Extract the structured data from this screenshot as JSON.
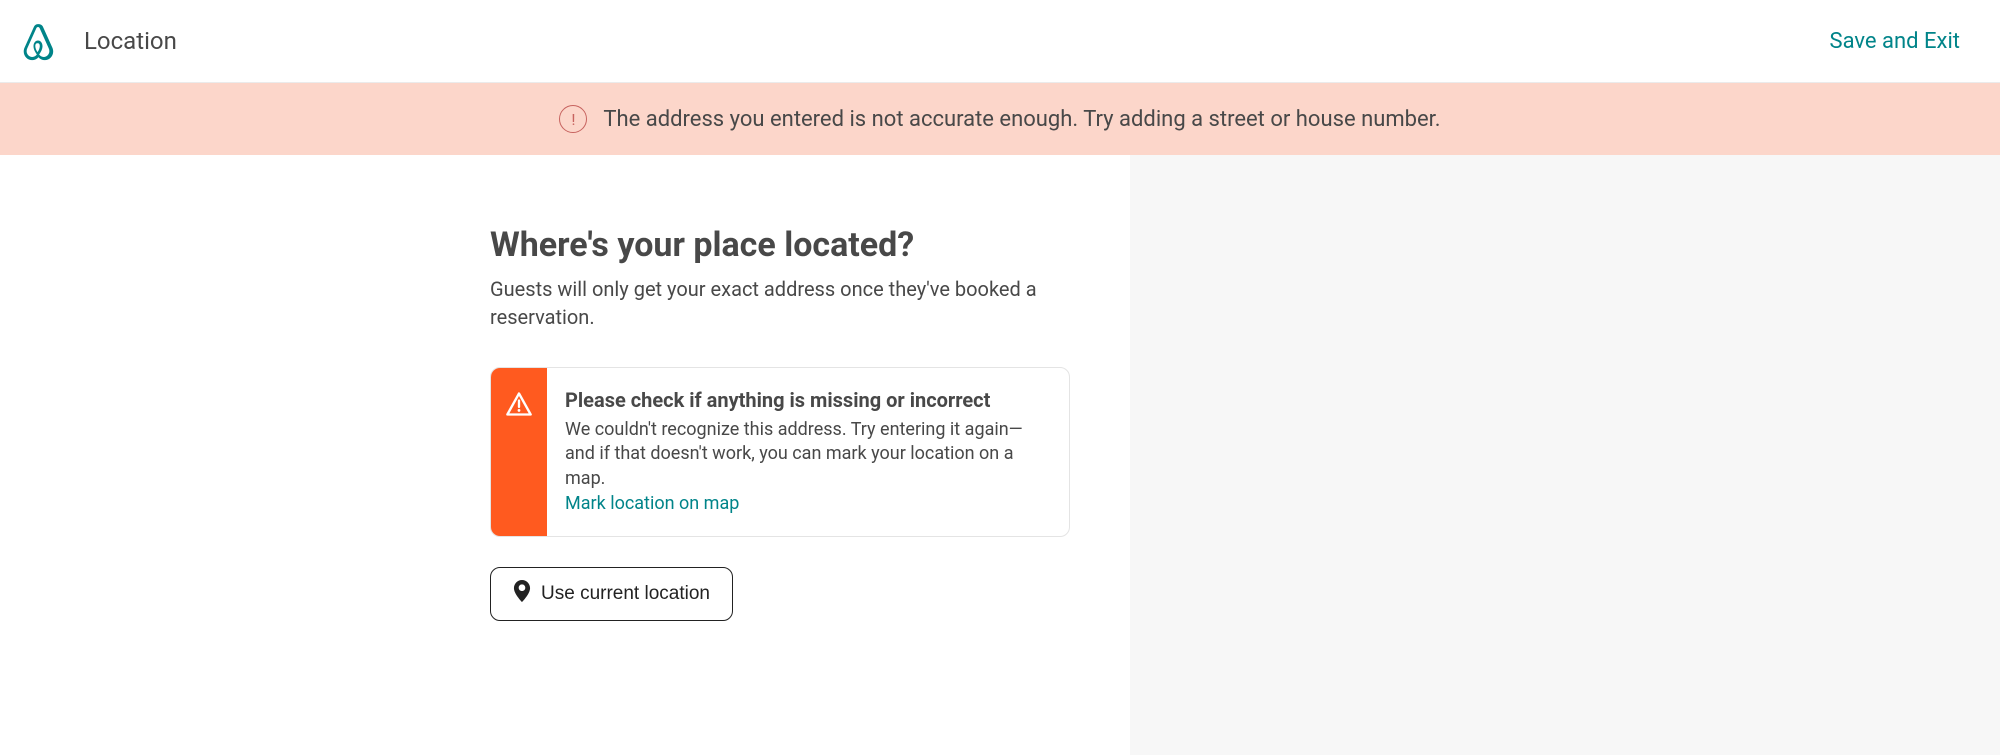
{
  "header": {
    "page_title": "Location",
    "save_exit": "Save and Exit"
  },
  "banner": {
    "message": "The address you entered is not accurate enough. Try adding a street or house number."
  },
  "main": {
    "heading": "Where's your place located?",
    "subheading": "Guests will only get your exact address once they've booked a reservation.",
    "warning": {
      "title": "Please check if anything is missing or incorrect",
      "body": "We couldn't recognize this address. Try entering it again—and if that doesn't work, you can mark your location on a map.",
      "link_label": "Mark location on map"
    },
    "use_current_location": "Use current location"
  }
}
